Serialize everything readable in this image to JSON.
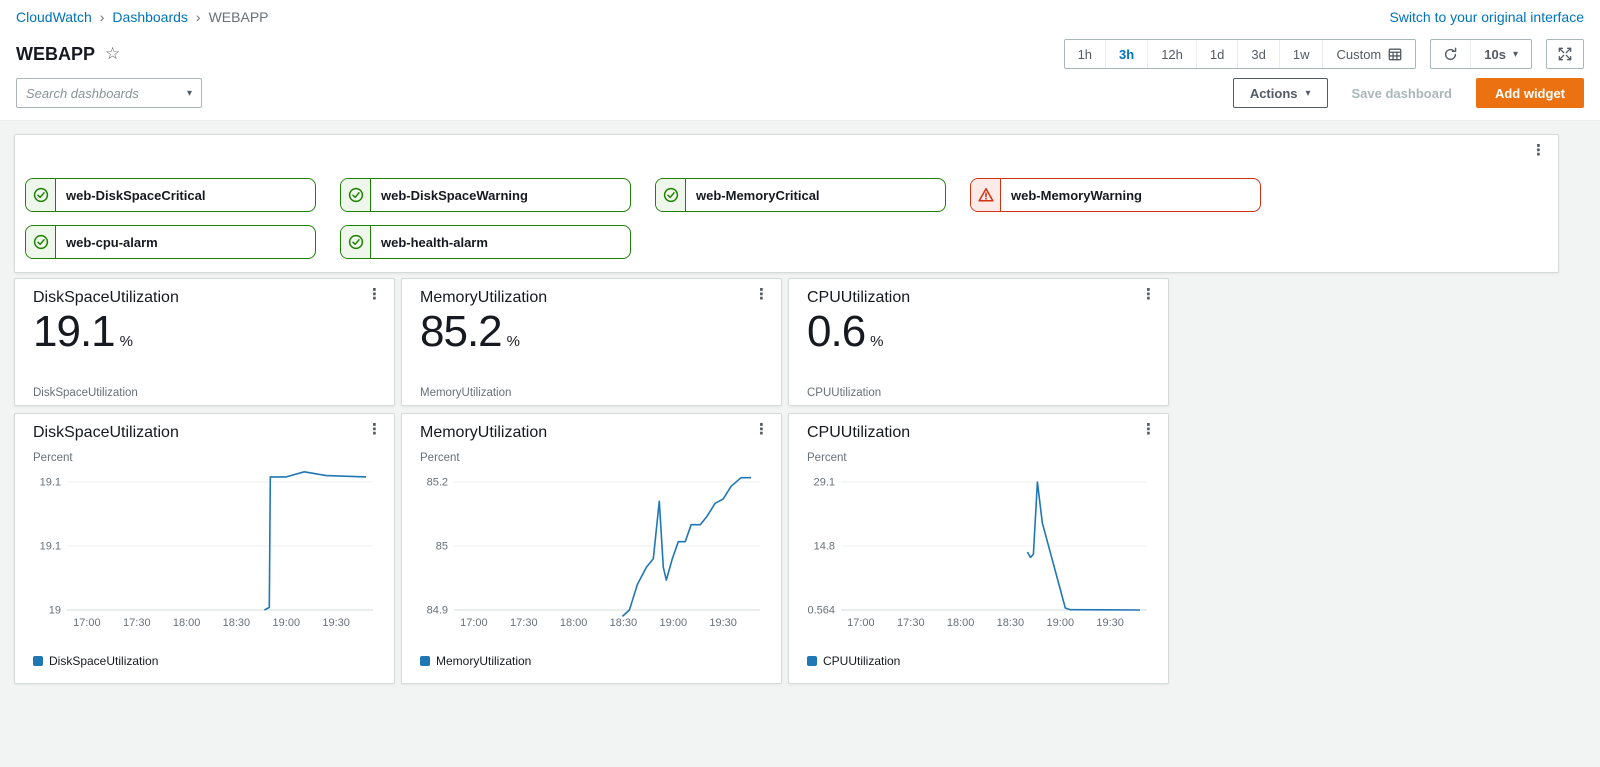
{
  "colors": {
    "link_blue": "#0073bb",
    "accent_orange": "#ec7211",
    "ok_green": "#1d8102",
    "alarm_red": "#d13212",
    "series_blue": "#1f77b4",
    "page_background": "#f2f3f3"
  },
  "breadcrumb": {
    "items": [
      "CloudWatch",
      "Dashboards",
      "WEBAPP"
    ]
  },
  "header": {
    "title": "WEBAPP",
    "switch_link": "Switch to your original interface"
  },
  "time_controls": {
    "ranges": [
      "1h",
      "3h",
      "12h",
      "1d",
      "3d",
      "1w"
    ],
    "selected": "3h",
    "custom_label": "Custom",
    "refresh_interval": "10s"
  },
  "toolbar": {
    "search_placeholder": "Search dashboards",
    "actions_label": "Actions",
    "save_label": "Save dashboard",
    "add_widget_label": "Add widget"
  },
  "alarms": [
    {
      "name": "web-DiskSpaceCritical",
      "state": "ok"
    },
    {
      "name": "web-DiskSpaceWarning",
      "state": "ok"
    },
    {
      "name": "web-MemoryCritical",
      "state": "ok"
    },
    {
      "name": "web-MemoryWarning",
      "state": "alarm"
    },
    {
      "name": "web-cpu-alarm",
      "state": "ok"
    },
    {
      "name": "web-health-alarm",
      "state": "ok"
    }
  ],
  "number_widgets": [
    {
      "title": "DiskSpaceUtilization",
      "value": "19.1",
      "unit": "%",
      "label": "DiskSpaceUtilization"
    },
    {
      "title": "MemoryUtilization",
      "value": "85.2",
      "unit": "%",
      "label": "MemoryUtilization"
    },
    {
      "title": "CPUUtilization",
      "value": "0.6",
      "unit": "%",
      "label": "CPUUtilization"
    }
  ],
  "chart_data": [
    {
      "type": "line",
      "title": "DiskSpaceUtilization",
      "ylabel": "Percent",
      "legend": "DiskSpaceUtilization",
      "x_tick_labels": [
        "17:00",
        "17:30",
        "18:00",
        "18:30",
        "19:00",
        "19:30"
      ],
      "x_tick_hours": [
        17.0,
        17.5,
        18.0,
        18.5,
        19.0,
        19.5
      ],
      "x_domain": [
        16.8,
        19.87
      ],
      "y_ticks": [
        {
          "value": 19.1,
          "label": "19.1"
        },
        {
          "value": 19.05,
          "label": "19.1"
        },
        {
          "value": 19.0,
          "label": "19"
        }
      ],
      "points": [
        [
          18.78,
          19.0
        ],
        [
          18.83,
          19.002
        ],
        [
          18.84,
          19.104
        ],
        [
          19.0,
          19.104
        ],
        [
          19.18,
          19.108
        ],
        [
          19.4,
          19.105
        ],
        [
          19.8,
          19.104
        ]
      ]
    },
    {
      "type": "line",
      "title": "MemoryUtilization",
      "ylabel": "Percent",
      "legend": "MemoryUtilization",
      "x_tick_labels": [
        "17:00",
        "17:30",
        "18:00",
        "18:30",
        "19:00",
        "19:30"
      ],
      "x_tick_hours": [
        17.0,
        17.5,
        18.0,
        18.5,
        19.0,
        19.5
      ],
      "x_domain": [
        16.8,
        19.87
      ],
      "y_ticks": [
        {
          "value": 85.2,
          "label": "85.2"
        },
        {
          "value": 85.05,
          "label": "85"
        },
        {
          "value": 84.9,
          "label": "84.9"
        }
      ],
      "points": [
        [
          18.49,
          84.885
        ],
        [
          18.56,
          84.9
        ],
        [
          18.64,
          84.96
        ],
        [
          18.73,
          85.0
        ],
        [
          18.8,
          85.02
        ],
        [
          18.86,
          85.155
        ],
        [
          18.9,
          85.0
        ],
        [
          18.93,
          84.97
        ],
        [
          18.99,
          85.02
        ],
        [
          19.05,
          85.06
        ],
        [
          19.12,
          85.06
        ],
        [
          19.18,
          85.1
        ],
        [
          19.27,
          85.1
        ],
        [
          19.34,
          85.12
        ],
        [
          19.42,
          85.15
        ],
        [
          19.5,
          85.16
        ],
        [
          19.58,
          85.19
        ],
        [
          19.68,
          85.21
        ],
        [
          19.78,
          85.21
        ]
      ]
    },
    {
      "type": "line",
      "title": "CPUUtilization",
      "ylabel": "Percent",
      "legend": "CPUUtilization",
      "x_tick_labels": [
        "17:00",
        "17:30",
        "18:00",
        "18:30",
        "19:00",
        "19:30"
      ],
      "x_tick_hours": [
        17.0,
        17.5,
        18.0,
        18.5,
        19.0,
        19.5
      ],
      "x_domain": [
        16.8,
        19.87
      ],
      "y_ticks": [
        {
          "value": 29.1,
          "label": "29.1"
        },
        {
          "value": 14.8,
          "label": "14.8"
        },
        {
          "value": 0.564,
          "label": "0.564"
        }
      ],
      "points": [
        [
          18.67,
          13.5
        ],
        [
          18.7,
          12.3
        ],
        [
          18.73,
          13.0
        ],
        [
          18.77,
          29.1
        ],
        [
          18.82,
          20.0
        ],
        [
          19.05,
          1.0
        ],
        [
          19.1,
          0.62
        ],
        [
          19.45,
          0.6
        ],
        [
          19.8,
          0.56
        ]
      ]
    }
  ]
}
